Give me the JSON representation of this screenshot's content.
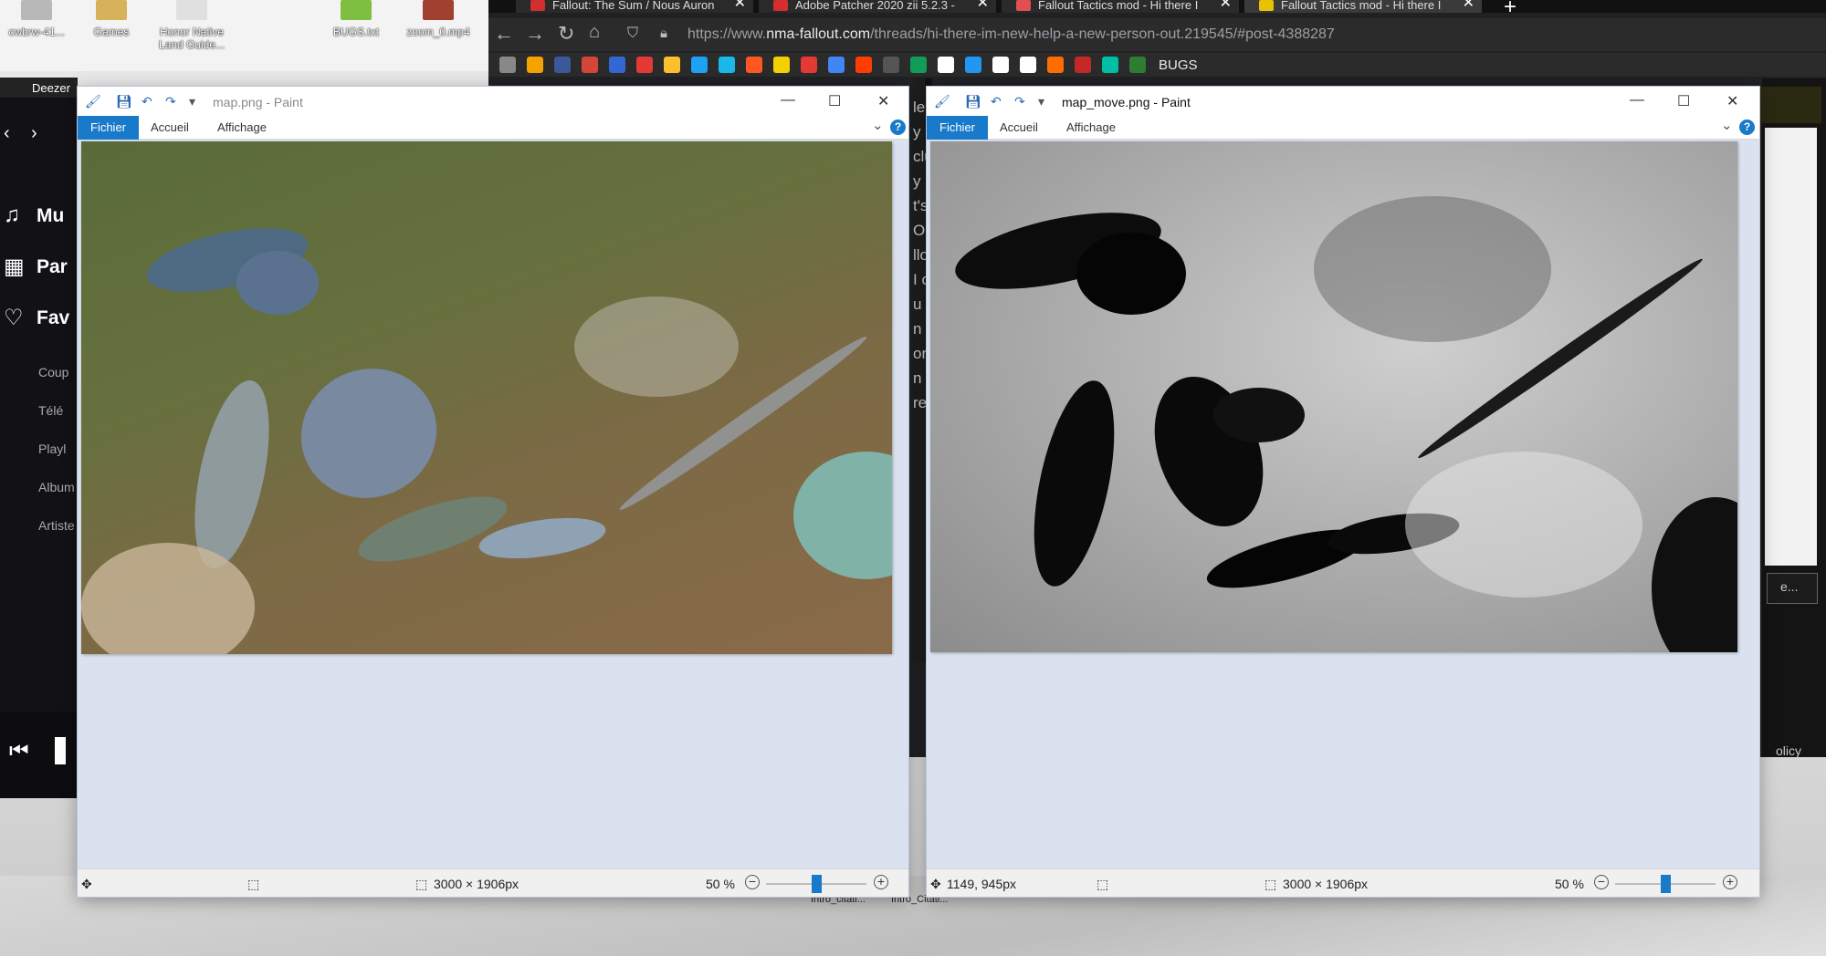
{
  "desktop": {
    "icons": [
      {
        "label": "cwbrw-41...",
        "color": "#b8b8b8"
      },
      {
        "label": "Games",
        "color": "#d6b25b"
      },
      {
        "label": "Honor Native Land Guide...",
        "color": "#e0e0e0"
      },
      {
        "label": "BUGS.txt",
        "color": "#7fbf3f"
      },
      {
        "label": "zoom_0.mp4",
        "color": "#a04030"
      }
    ],
    "files": [
      "Intro_citati...",
      "Intro_Citati..."
    ]
  },
  "browser": {
    "tabs": [
      {
        "title": "Fallout: The Sum / Nous Auron",
        "color": "#d32f2f"
      },
      {
        "title": "Adobe Patcher 2020 zii 5.2.3 -",
        "color": "#d32f2f"
      },
      {
        "title": "Fallout Tactics mod - Hi there I",
        "color": "#e05050"
      },
      {
        "title": "Fallout Tactics mod - Hi there I",
        "color": "#e6c200"
      }
    ],
    "url_prefix": "https://www.",
    "url_domain": "nma-fallout.com",
    "url_path": "/threads/hi-there-im-new-help-a-new-person-out.219545/#post-4388287",
    "bookmark_label": "BUGS",
    "bookmark_colors": [
      "#888",
      "#f4a300",
      "#3b5998",
      "#d44638",
      "#3367d6",
      "#e53935",
      "#fbc02d",
      "#1da1f2",
      "#1ab7ea",
      "#ff5722",
      "#f5d000",
      "#e53935",
      "#4285f4",
      "#ff3d00",
      "#555",
      "#0f9d58",
      "#fff",
      "#2196f3",
      "#fff",
      "#fff",
      "#ff6d00",
      "#c62828",
      "#00bfa5",
      "#2e7d32"
    ],
    "page_snippets": [
      "le",
      "y",
      "clu",
      "y c",
      "t's",
      "OD",
      "llo",
      "I c",
      "u c",
      "n",
      "orld",
      "n l",
      "re"
    ],
    "right_texts": [
      "e...",
      "olicy"
    ]
  },
  "deezer": {
    "title": "Deezer",
    "nav": [
      {
        "icon": "♫",
        "label": "Mu"
      },
      {
        "icon": "▦",
        "label": "Par"
      },
      {
        "icon": "♡",
        "label": "Fav"
      }
    ],
    "sub": [
      "Coup",
      "Télé",
      "Playl",
      "Album",
      "Artiste"
    ]
  },
  "paint_left": {
    "title": "map.png - Paint",
    "tabs": [
      "Fichier",
      "Accueil",
      "Affichage"
    ],
    "dimensions": "3000 × 1906px",
    "zoom": "50 %",
    "zoom_level": 0.5
  },
  "paint_right": {
    "title": "map_move.png - Paint",
    "tabs": [
      "Fichier",
      "Accueil",
      "Affichage"
    ],
    "cursor_pos": "1149, 945px",
    "dimensions": "3000 × 1906px",
    "zoom": "50 %",
    "zoom_level": 0.5
  }
}
